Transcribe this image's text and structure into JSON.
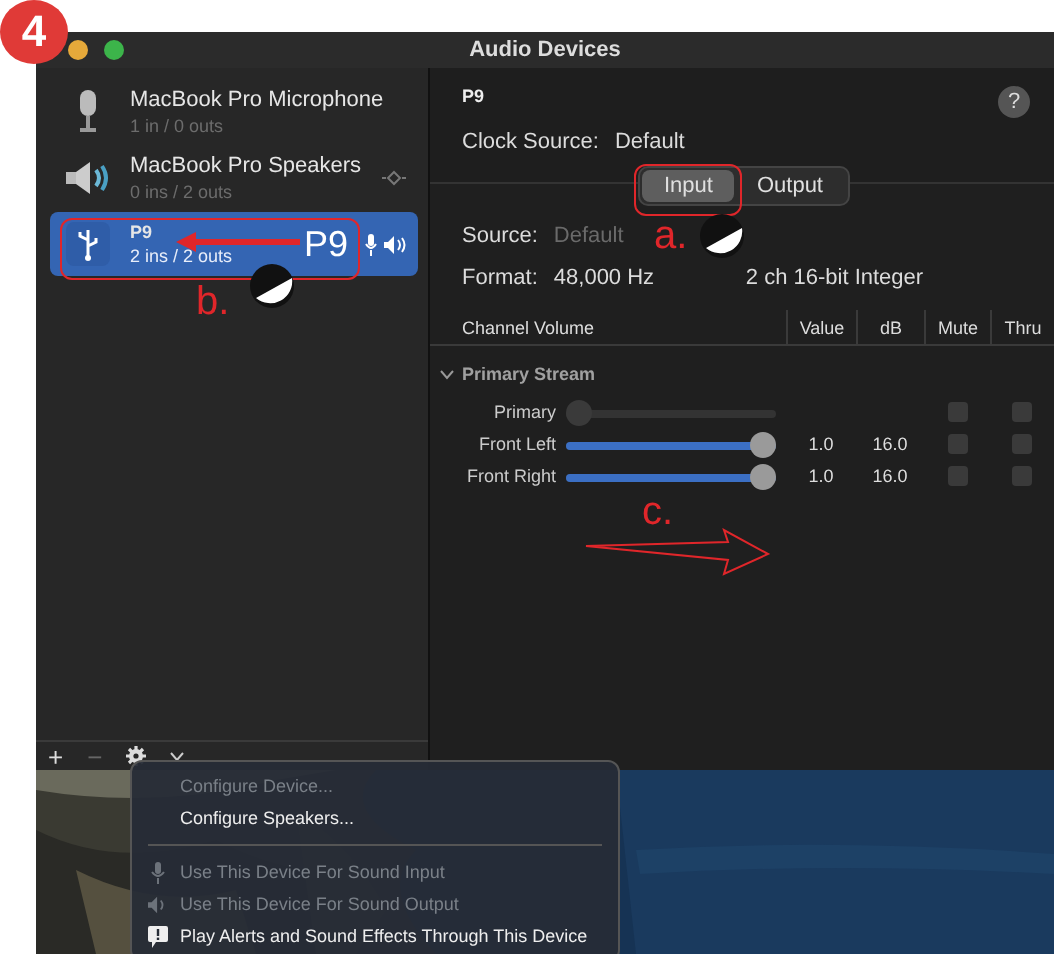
{
  "step_badge": "4",
  "window": {
    "title": "Audio Devices"
  },
  "devices": [
    {
      "name": "MacBook Pro Microphone",
      "io": "1 in / 0 outs",
      "kind": "microphone",
      "selected": false
    },
    {
      "name": "MacBook Pro Speakers",
      "io": "0 ins / 2 outs",
      "kind": "speaker",
      "selected": false,
      "alert_sound": true
    },
    {
      "name": "P9",
      "io": "2 ins / 2 outs",
      "kind": "usb",
      "selected": true,
      "default_input": true,
      "default_output": true
    }
  ],
  "toolbar": {
    "add": "+",
    "remove": "−",
    "remove_disabled": true
  },
  "detail": {
    "device_name": "P9",
    "help": "?",
    "clock_source_label": "Clock Source:",
    "clock_source": "Default",
    "segments": [
      {
        "label": "Input",
        "selected": true
      },
      {
        "label": "Output",
        "selected": false
      }
    ],
    "source_label": "Source:",
    "source": "Default",
    "format_label": "Format:",
    "rate": "48,000 Hz",
    "format": "2 ch 16-bit Integer",
    "columns": [
      "Channel Volume",
      "Value",
      "dB",
      "Mute",
      "Thru"
    ],
    "stream": {
      "label": "Primary Stream",
      "expanded": true,
      "channels": [
        {
          "name": "Primary",
          "disabled": true,
          "level": 0,
          "mute": false,
          "thru": false
        },
        {
          "name": "Front Left",
          "disabled": false,
          "level": 1,
          "value": "1.0",
          "db": "16.0",
          "mute": false,
          "thru": false
        },
        {
          "name": "Front Right",
          "disabled": false,
          "level": 1,
          "value": "1.0",
          "db": "16.0",
          "mute": false,
          "thru": false
        }
      ]
    }
  },
  "menu": [
    {
      "kind": "plain",
      "label": "Configure Device...",
      "disabled": true
    },
    {
      "kind": "plain",
      "label": "Configure Speakers...",
      "disabled": false
    },
    {
      "kind": "separator"
    },
    {
      "kind": "input",
      "label": "Use This Device For Sound Input",
      "disabled": true
    },
    {
      "kind": "output",
      "label": "Use This Device For Sound Output",
      "disabled": true
    },
    {
      "kind": "alert",
      "label": "Play Alerts and Sound Effects Through This Device",
      "disabled": false
    }
  ],
  "annotations": {
    "input_marker": "a.",
    "device_marker": "b.",
    "panel_marker": "c.",
    "device_callout": "P9"
  }
}
